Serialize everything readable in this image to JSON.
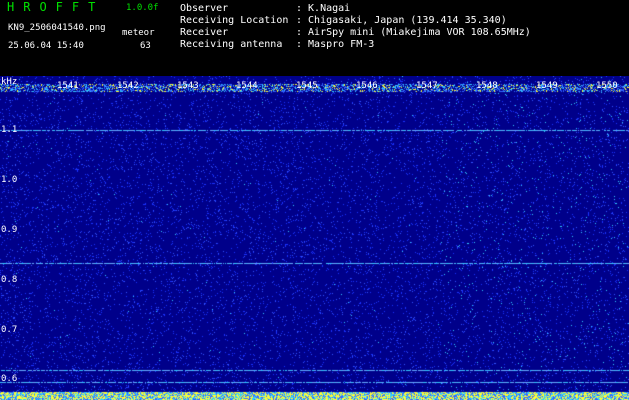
{
  "header": {
    "app_name": "HROFFT",
    "version": "1.0.0f",
    "filename": "KN9_2506041540.png",
    "datetime": "25.06.04 15:40",
    "meteor_label": "meteor",
    "meteor_count": "63"
  },
  "meta": [
    {
      "label": "Observer",
      "value": ": K.Nagai"
    },
    {
      "label": "Receiving Location",
      "value": ": Chigasaki, Japan (139.414 35.340)"
    },
    {
      "label": "Receiver",
      "value": ": AirSpy mini (Miakejima VOR 108.65MHz)"
    },
    {
      "label": "Receiving antenna",
      "value": ": Maspro FM-3"
    }
  ],
  "axis": {
    "y_unit": "kHz",
    "y_ticks": [
      "1.1",
      "1.0",
      "0.9",
      "0.8",
      "0.7",
      "0.6"
    ],
    "x_ticks": [
      "1541",
      "1542",
      "1543",
      "1544",
      "1545",
      "1546",
      "1547",
      "1548",
      "1549",
      "1550"
    ]
  },
  "colors": {
    "background": "#00008a",
    "noise_low": "#1a33ff",
    "noise_high": "#33ccff",
    "signal": "#ffff33"
  }
}
